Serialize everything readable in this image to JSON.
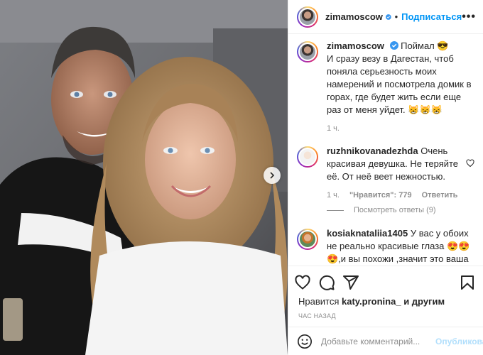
{
  "post": {
    "username": "zimamoscow",
    "follow_label": "Подписаться",
    "more_label": "•••"
  },
  "caption": {
    "username": "zimamoscow",
    "text": "Поймал 😎\nИ сразу везу в Дагестан, чтоб поняла серьезность моих намерений и посмотрела домик в горах, где будет жить если еще раз от меня уйдет. 😸😸😸",
    "time": "1 ч."
  },
  "comments": [
    {
      "username": "ruzhnikovanadezhda",
      "text": "Очень красивая девушка. Не теряйте её. От неё веет нежностью.",
      "time": "1 ч.",
      "likes": "\"Нравится\": 779",
      "reply_label": "Ответить",
      "view_replies": "Посмотреть ответы (9)"
    },
    {
      "username": "kosiaknataliia1405",
      "text": "У вас у обоих не реально красивые глаза 😍😍😍,и вы похожи ,значит это ваша судьба 😍😍❤️,море любви вам😍👌❤️"
    }
  ],
  "likes": {
    "prefix": "Нравится",
    "user": "katy.pronina_",
    "suffix": "и другим"
  },
  "timestamp": "час назад",
  "add_comment": {
    "placeholder": "Добавьте комментарий...",
    "publish_label": "Опубликовать"
  },
  "icons": {
    "verified": "verified-badge-icon",
    "heart": "heart-icon",
    "comment": "comment-icon",
    "share": "share-icon",
    "save": "bookmark-icon",
    "emoji": "emoji-icon",
    "next": "chevron-right-icon"
  },
  "colors": {
    "accent": "#0095f6",
    "verified": "#3897f0",
    "muted": "#8e8e8e",
    "publish_disabled": "#b2dffc"
  }
}
